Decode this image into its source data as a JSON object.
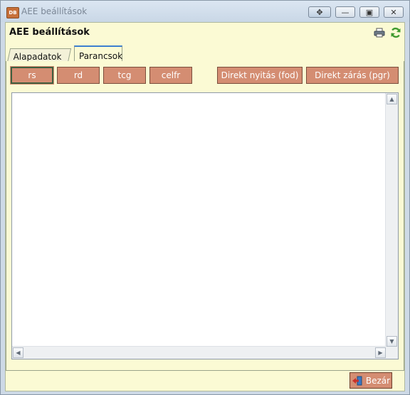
{
  "window": {
    "app_icon_text": "DB",
    "title": "AEE beállítások",
    "buttons": {
      "move": "✥",
      "minimize": "—",
      "maximize": "▣",
      "close": "✕"
    }
  },
  "header": {
    "title": "AEE beállítások"
  },
  "tabs": [
    {
      "label": "Alapadatok",
      "active": false
    },
    {
      "label": "Parancsok",
      "active": true
    }
  ],
  "commands": {
    "rs": "rs",
    "rd": "rd",
    "tcg": "tcg",
    "celfr": "celfr",
    "fod": "Direkt nyitás (fod)",
    "pgr": "Direkt zárás (pgr)"
  },
  "output": {
    "value": ""
  },
  "footer": {
    "close_label": "Bezár"
  },
  "colors": {
    "command_button": "#d48d72",
    "panel_bg": "#fbfad4",
    "active_tab_accent": "#3c7fd0"
  }
}
